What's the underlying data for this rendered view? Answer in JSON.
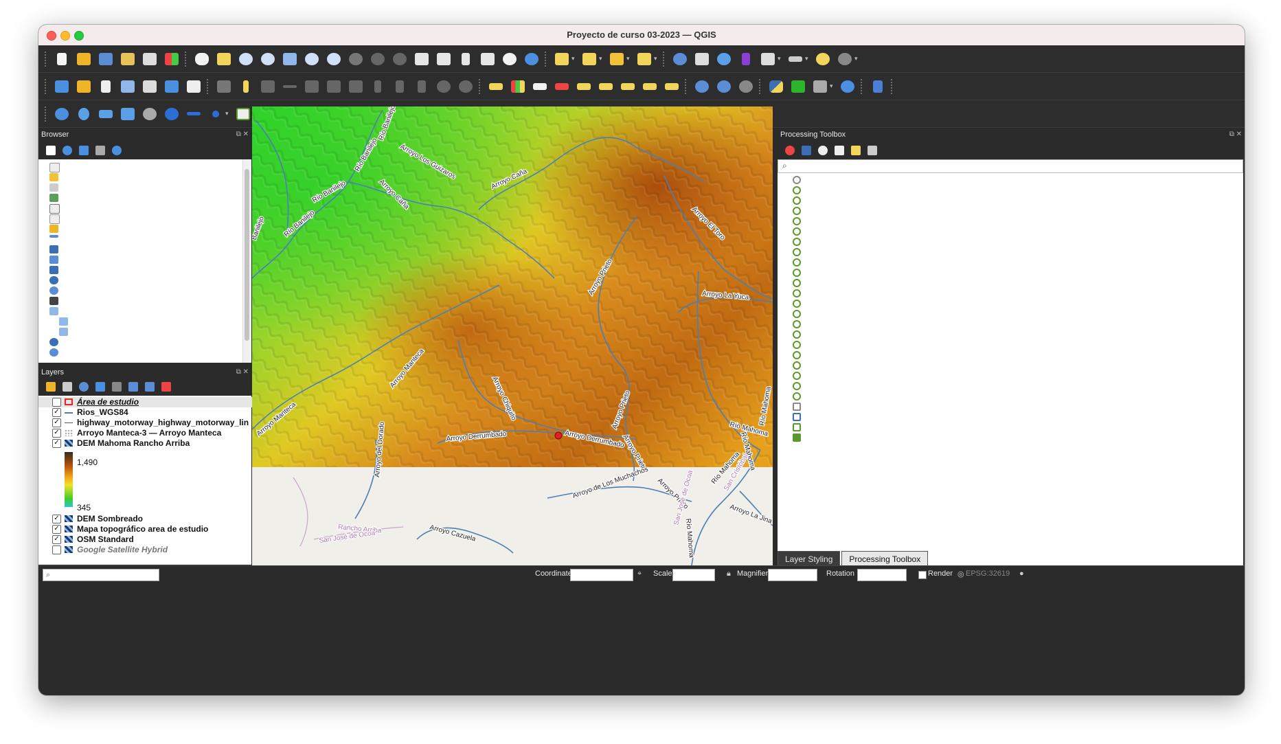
{
  "window": {
    "title": "Proyecto de curso 03-2023 — QGIS"
  },
  "browser": {
    "title": "Browser"
  },
  "layers": {
    "title": "Layers",
    "items": [
      {
        "name": "Área de estudio",
        "checked": false,
        "selected": true,
        "italic": true,
        "underline": true
      },
      {
        "name": "Rios_WGS84",
        "checked": true
      },
      {
        "name": "highway_motorway_highway_motorway_lin",
        "checked": true
      },
      {
        "name": "Arroyo Manteca-3 — Arroyo Manteca",
        "checked": true
      },
      {
        "name": "DEM Mahoma Rancho Arriba",
        "checked": true
      },
      {
        "name": "DEM Sombreado",
        "checked": true
      },
      {
        "name": "Mapa topográfico area de estudio",
        "checked": true
      },
      {
        "name": "OSM Standard",
        "checked": true
      },
      {
        "name": "Google Satellite Hybrid",
        "checked": false,
        "italic": true
      }
    ],
    "legend": {
      "max": "1,490",
      "min": "345"
    }
  },
  "processing": {
    "title": "Processing Toolbox"
  },
  "tabs": [
    {
      "label": "Layer Styling",
      "active": false
    },
    {
      "label": "Processing Toolbox",
      "active": true
    }
  ],
  "status": {
    "coordinate_label": "Coordinate",
    "scale_label": "Scale",
    "magnifier_label": "Magnifier",
    "rotation_label": "Rotation",
    "render_label": "Render",
    "crs": "EPSG:32619"
  },
  "map_labels": [
    "Río Banilejo",
    "Río Banilejo",
    "Río Banilejo",
    "Río Banilejo",
    "Banilejo",
    "Arroyo Los Guizaros",
    "Arroyo Caña",
    "Arroyo Caña",
    "Arroyo El Toro",
    "Arroyo Prieto",
    "Arroyo La Yuca",
    "Arroyo Manteca",
    "Arroyo Manteca",
    "Arroyo Chiquito",
    "Arroyo Derrumbado",
    "Arroyo Derrumbado",
    "Arroyo Prieto",
    "Arroyo Prieto",
    "Arroyo del Dorado",
    "Río Mahoma",
    "Río Mahoma",
    "Río Mahoma",
    "Arroyo de Los Muchachos",
    "Arroyo Prieto",
    "Río Mahoma",
    "Río Mahoma",
    "Arroyo La Jina",
    "San Cristóbal",
    "San José de Ocoa",
    "Arroyo Cazuela",
    "Rancho Arriba",
    "San José de Ocoa"
  ],
  "colors": {
    "accent": "#3a6fb5",
    "river": "#4a7fb8",
    "dem_high": "#b5540f",
    "dem_low": "#3fcf2a"
  }
}
